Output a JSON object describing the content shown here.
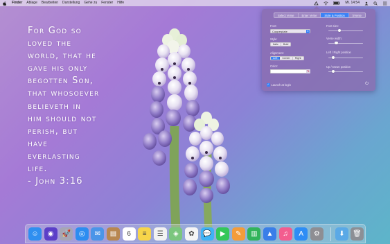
{
  "menubar": {
    "app_name": "Finder",
    "items": [
      "Ablage",
      "Bearbeiten",
      "Darstellung",
      "Gehe zu",
      "Fenster",
      "Hilfe"
    ],
    "clock": "Mi. 14:54"
  },
  "verse": {
    "lines": [
      "For God so",
      "loved the",
      "world, that he",
      "gave his only",
      "begotten Son,",
      "that whosoever",
      "believeth in",
      "him should not",
      "perish, but",
      "have",
      "everlasting",
      "life.",
      "- John 3:16"
    ]
  },
  "prefs": {
    "tabs": [
      "Select Verse",
      "Enter Verse",
      "Style & Position",
      "bVerse"
    ],
    "active_tab": 2,
    "font_label": "Font:",
    "font_value": "Copperplate",
    "style_label": "Style:",
    "style_options": [
      "Italic",
      "Bold"
    ],
    "alignment_label": "Alignment:",
    "alignment_options": [
      "Left",
      "Center",
      "Right"
    ],
    "alignment_selected": 0,
    "color_label": "Color:",
    "font_size_label": "Font size:",
    "font_size_level": 0.3,
    "verse_width_label": "Verse width:",
    "verse_width_level": 0.2,
    "left_right_label": "Left / Right position",
    "left_right_level": 0.1,
    "up_down_label": "Up / Down position",
    "up_down_level": 0.1,
    "launch_label": "Launch at login",
    "launch_checked": true
  },
  "dock": {
    "apps": [
      {
        "name": "finder-icon",
        "color": "#2f8ff0",
        "glyph": "☺"
      },
      {
        "name": "siri-icon",
        "color": "#5b3fc8",
        "glyph": "◉"
      },
      {
        "name": "launchpad-icon",
        "color": "#a6a6b4",
        "glyph": "🚀"
      },
      {
        "name": "safari-icon",
        "color": "#2d8df0",
        "glyph": "◎"
      },
      {
        "name": "mail-icon",
        "color": "#4a95e8",
        "glyph": "✉"
      },
      {
        "name": "contacts-icon",
        "color": "#b88750",
        "glyph": "▤"
      },
      {
        "name": "calendar-icon",
        "color": "#ffffff",
        "glyph": "6"
      },
      {
        "name": "notes-icon",
        "color": "#f7d54a",
        "glyph": "≡"
      },
      {
        "name": "reminders-icon",
        "color": "#f2f2f2",
        "glyph": "☰"
      },
      {
        "name": "maps-icon",
        "color": "#7bc67e",
        "glyph": "◈"
      },
      {
        "name": "photos-icon",
        "color": "#f5f5f5",
        "glyph": "✿"
      },
      {
        "name": "messages-icon",
        "color": "#3fb3f4",
        "glyph": "💬"
      },
      {
        "name": "facetime-icon",
        "color": "#34c759",
        "glyph": "▶"
      },
      {
        "name": "pages-icon",
        "color": "#f39c3a",
        "glyph": "✎"
      },
      {
        "name": "numbers-icon",
        "color": "#32b45a",
        "glyph": "▥"
      },
      {
        "name": "keynote-icon",
        "color": "#3a7ee8",
        "glyph": "▲"
      },
      {
        "name": "itunes-icon",
        "color": "#f35d8f",
        "glyph": "♫"
      },
      {
        "name": "app-store-icon",
        "color": "#2e8df5",
        "glyph": "A"
      },
      {
        "name": "system-preferences-icon",
        "color": "#8e8e93",
        "glyph": "⚙"
      },
      {
        "name": "downloads-folder-icon",
        "color": "#5aa9e6",
        "glyph": "⬇"
      },
      {
        "name": "trash-icon",
        "color": "#8c8f95",
        "glyph": "🗑"
      }
    ]
  }
}
